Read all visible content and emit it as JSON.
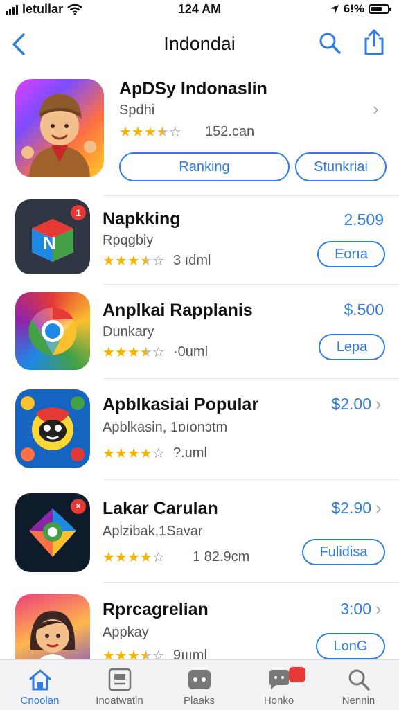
{
  "status_bar": {
    "carrier": "Ietullar",
    "time": "124 AM",
    "battery": "6!%",
    "battery_level": 0.7
  },
  "nav": {
    "title": "Indondai"
  },
  "featured": {
    "name": "ApDSy Indonaslin",
    "subtitle": "Spdhi",
    "rating": 3.5,
    "rating_text": "152.can",
    "button_primary": "Ranking",
    "button_secondary": "Stunkriai"
  },
  "apps": [
    {
      "name": "Napkking",
      "subtitle": "Rpqgbiy",
      "rating": 3.5,
      "rating_text": "3 ıdml",
      "price": "2.509",
      "button": "Eorıa",
      "chevron": false
    },
    {
      "name": "Anplkai Rapplanis",
      "subtitle": "Dunkary",
      "rating": 3.5,
      "rating_text": "·0uml",
      "price": "$.500",
      "button": "Lepa",
      "chevron": false
    },
    {
      "name": "Apblkasiai Popular",
      "subtitle": "Apblkasin, 1ɒıonɔtm",
      "rating": 4,
      "rating_text": "?.uml",
      "price": "$2.00",
      "button": "",
      "chevron": true
    },
    {
      "name": "Lakar Carulan",
      "subtitle": "Aplzibak,1Savar",
      "rating": 4,
      "rating_text": "1 82.9cm",
      "price": "$2.90",
      "button": "Fulidisa",
      "chevron": true
    },
    {
      "name": "Rprcagrelian",
      "subtitle": "Appkay",
      "rating": 3.5,
      "rating_text": "9ıııml",
      "price": "3:00",
      "button": "LonG",
      "chevron": true
    }
  ],
  "tabs": [
    {
      "label": "Cnoolan",
      "icon": "home-icon",
      "active": true
    },
    {
      "label": "Inoatwatin",
      "icon": "today-icon",
      "active": false
    },
    {
      "label": "Plaaks",
      "icon": "games-icon",
      "active": false
    },
    {
      "label": "Honko",
      "icon": "chat-icon",
      "active": false
    },
    {
      "label": "Nennin",
      "icon": "search-icon",
      "active": false
    }
  ],
  "colors": {
    "accent": "#2f7de1",
    "star": "#f4b400",
    "badge": "#e53935"
  }
}
